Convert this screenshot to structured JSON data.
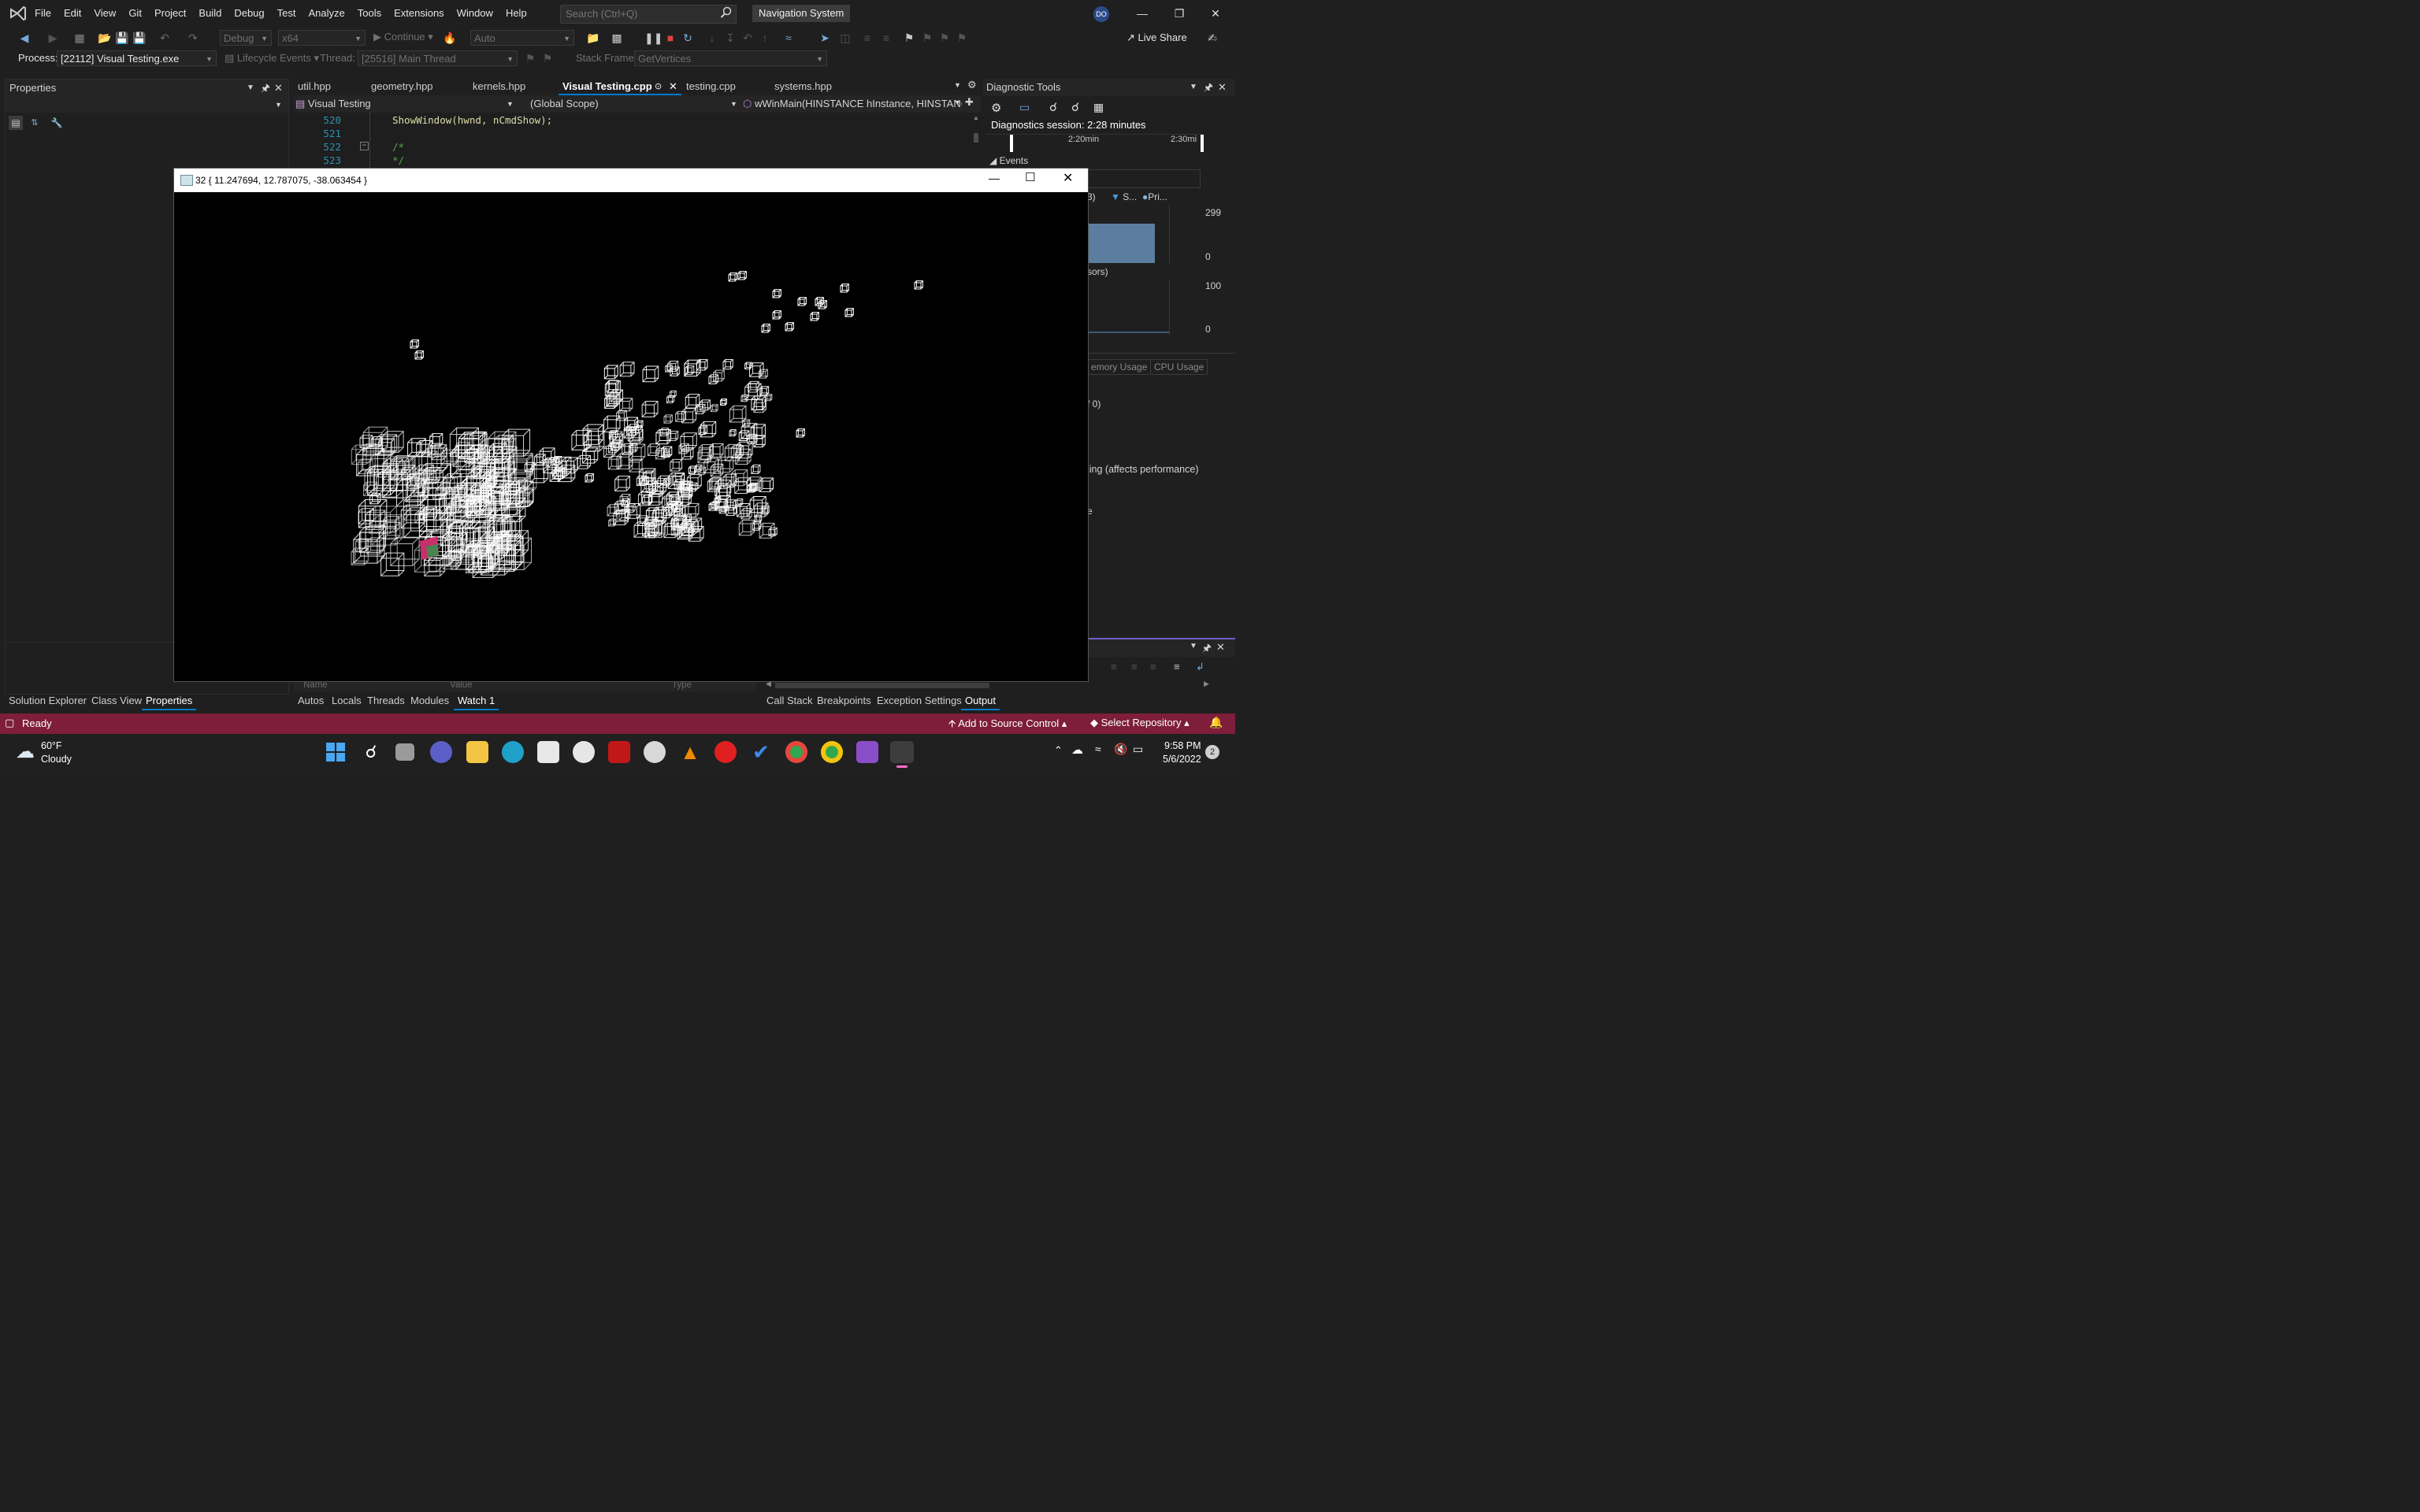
{
  "menubar": {
    "items": [
      "File",
      "Edit",
      "View",
      "Git",
      "Project",
      "Build",
      "Debug",
      "Test",
      "Analyze",
      "Tools",
      "Extensions",
      "Window",
      "Help"
    ],
    "search_placeholder": "Search (Ctrl+Q)",
    "solution_name": "Navigation System",
    "user_initials": "DO"
  },
  "toolbar": {
    "config": "Debug",
    "platform": "x64",
    "continue_label": "Continue",
    "auto_label": "Auto",
    "live_share": "Live Share"
  },
  "debug_location": {
    "process_label": "Process:",
    "process_value": "[22112] Visual Testing.exe",
    "lifecycle_label": "Lifecycle Events",
    "thread_label": "Thread:",
    "thread_value": "[25516] Main Thread",
    "stack_label": "Stack Frame:",
    "stack_value": "GetVertices"
  },
  "properties": {
    "title": "Properties"
  },
  "editor": {
    "tabs": [
      "util.hpp",
      "geometry.hpp",
      "kernels.hpp",
      "Visual Testing.cpp",
      "testing.cpp",
      "systems.hpp"
    ],
    "active_tab": "Visual Testing.cpp",
    "nav": {
      "project": "Visual Testing",
      "scope": "(Global Scope)",
      "member": "wWinMain(HINSTANCE hInstance, HINSTANC"
    },
    "lines": [
      {
        "num": "520",
        "text": "ShowWindow(hwnd, nCmdShow);"
      },
      {
        "num": "521",
        "text": ""
      },
      {
        "num": "522",
        "text": "/*"
      },
      {
        "num": "523",
        "text": "*/"
      }
    ]
  },
  "diagnostics": {
    "title": "Diagnostic Tools",
    "session": "Diagnostics session: 2:28 minutes",
    "time_ticks": [
      "2:20min",
      "2:30mi"
    ],
    "events_label": "Events",
    "legend_partial": "3)",
    "legend_s": "S...",
    "legend_p": "Pri...",
    "mem_max": "299",
    "mem_min": "0",
    "cpu_label_partial": "sors)",
    "cpu_max": "100",
    "cpu_min": "0",
    "tabs": [
      "emory Usage",
      "CPU Usage"
    ],
    "text1": "f 0)",
    "text2": "ling (affects performance)",
    "text3": "e"
  },
  "float_window": {
    "title": "32 { 11.247694, 12.787075, -38.063454 }"
  },
  "watch": {
    "headers": [
      "Name",
      "Value",
      "Type"
    ]
  },
  "bottom_tabs_left": [
    "Solution Explorer",
    "Class View",
    "Properties"
  ],
  "bottom_tabs_mid": [
    "Autos",
    "Locals",
    "Threads",
    "Modules",
    "Watch 1"
  ],
  "bottom_tabs_right": [
    "Call Stack",
    "Breakpoints",
    "Exception Settings",
    "Output"
  ],
  "status": {
    "ready": "Ready",
    "source_control": "Add to Source Control",
    "repository": "Select Repository"
  },
  "taskbar": {
    "temperature": "60°F",
    "weather": "Cloudy",
    "time": "9:58 PM",
    "date": "5/6/2022",
    "notifications": "2"
  },
  "colors": {
    "accent": "#007acc",
    "status_bar": "#7e1e3a",
    "vs_purple": "#9b59d0"
  }
}
